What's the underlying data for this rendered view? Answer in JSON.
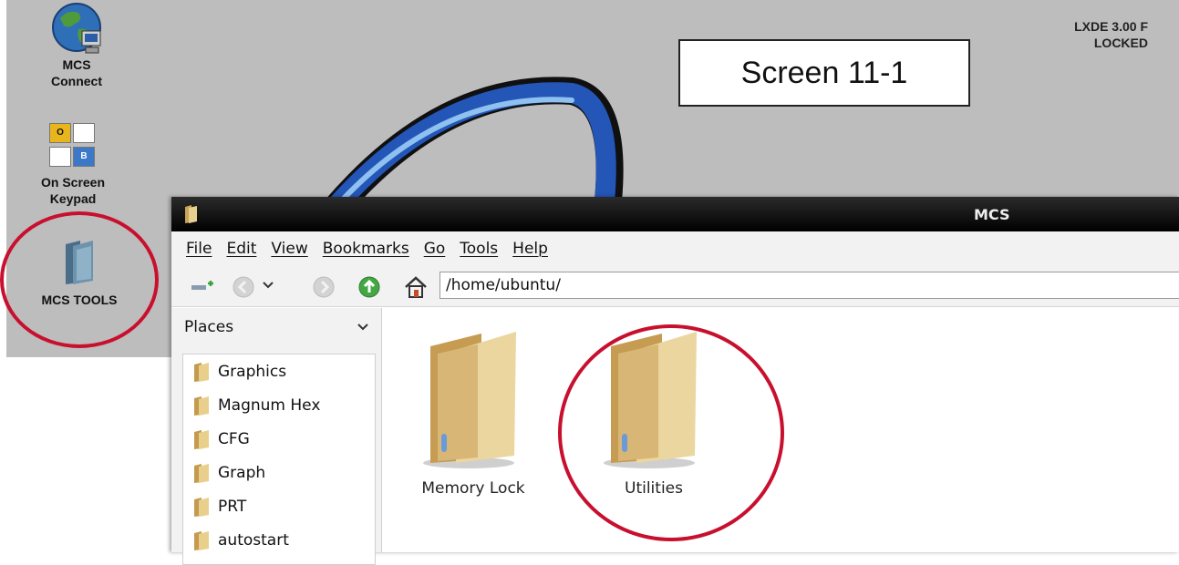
{
  "desktop": {
    "status_line1": "LXDE 3.00 F",
    "status_line2": "LOCKED",
    "screen_label": "Screen 11-1",
    "icons": [
      {
        "label": "MCS\nConnect",
        "icon": "globe-computer-icon"
      },
      {
        "label": "On Screen\nKeypad",
        "icon": "keypad-icon",
        "key1": "O",
        "key2": "B"
      },
      {
        "label": "MCS TOOLS",
        "icon": "folder-icon"
      }
    ],
    "highlight_color": "#c8102e",
    "background_color": "#bdbdbd"
  },
  "window": {
    "title": "MCS",
    "menu": [
      "File",
      "Edit",
      "View",
      "Bookmarks",
      "Go",
      "Tools",
      "Help"
    ],
    "path": "/home/ubuntu/",
    "sidebar": {
      "header": "Places",
      "items": [
        "Graphics",
        "Magnum Hex",
        "CFG",
        "Graph",
        "PRT",
        "autostart"
      ]
    },
    "files": [
      "Memory Lock",
      "Utilities"
    ]
  }
}
